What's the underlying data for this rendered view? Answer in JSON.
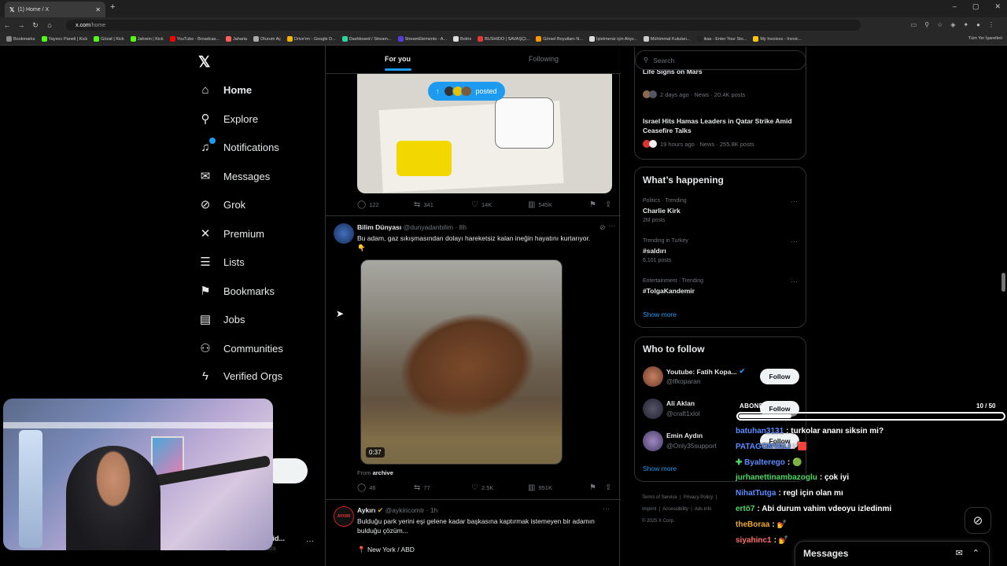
{
  "browser": {
    "tab_title": "(1) Home / X",
    "url_host": "x.com",
    "url_path": "/home",
    "bookmarks": [
      {
        "label": "Bookmarks",
        "color": "#888888"
      },
      {
        "label": "Yayıncı Paneli | Kick",
        "color": "#53fc18"
      },
      {
        "label": "Gözat | Kick",
        "color": "#53fc18"
      },
      {
        "label": "Jahrein | Kick",
        "color": "#53fc18"
      },
      {
        "label": "YouTube - Broadcas...",
        "color": "#ff0000"
      },
      {
        "label": "Jaharia",
        "color": "#ff5c5c"
      },
      {
        "label": "Oturum Aç",
        "color": "#aaaaaa"
      },
      {
        "label": "Drive'ım - Google D...",
        "color": "#f4b400"
      },
      {
        "label": "Dashboard / Stream...",
        "color": "#2bd5a0"
      },
      {
        "label": "StreamElements - A...",
        "color": "#5a3bdd"
      },
      {
        "label": "Botrix",
        "color": "#dddddd"
      },
      {
        "label": "BUSHIDO | SAVAŞÇI...",
        "color": "#e53935"
      },
      {
        "label": "Görsel Boyutlanı N...",
        "color": "#ff9800"
      },
      {
        "label": "İşletmeniz için Alışv...",
        "color": "#dddddd"
      },
      {
        "label": "Mühimmat Kutuları...",
        "color": "#cccccc"
      },
      {
        "label": "ikas - Enter Your Sto...",
        "color": "#222222"
      },
      {
        "label": "My Invoices - Invoic...",
        "color": "#f9c513"
      }
    ],
    "all_bookmarks": "Tüm Yer İşaretleri"
  },
  "nav": {
    "items": [
      {
        "label": "Home",
        "icon": "home-icon",
        "glyph": "⌂",
        "active": true
      },
      {
        "label": "Explore",
        "icon": "search-icon",
        "glyph": "⚲"
      },
      {
        "label": "Notifications",
        "icon": "bell-icon",
        "glyph": "♫",
        "badge": true
      },
      {
        "label": "Messages",
        "icon": "mail-icon",
        "glyph": "✉"
      },
      {
        "label": "Grok",
        "icon": "grok-icon",
        "glyph": "⊘"
      },
      {
        "label": "Premium",
        "icon": "x-premium-icon",
        "glyph": "✕"
      },
      {
        "label": "Lists",
        "icon": "list-icon",
        "glyph": "☰"
      },
      {
        "label": "Bookmarks",
        "icon": "bookmark-icon",
        "glyph": "⚑"
      },
      {
        "label": "Jobs",
        "icon": "briefcase-icon",
        "glyph": "▤"
      },
      {
        "label": "Communities",
        "icon": "people-icon",
        "glyph": "⚇"
      },
      {
        "label": "Verified Orgs",
        "icon": "lightning-icon",
        "glyph": "ϟ"
      }
    ],
    "profile_name": "shid...",
    "profile_handle": "@bushidowildcats"
  },
  "feed": {
    "tabs": {
      "for_you": "For you",
      "following": "Following"
    },
    "posted_pill": "posted",
    "post1_actions": {
      "replies": "122",
      "reposts": "341",
      "likes": "14K",
      "views": "545K"
    },
    "post2": {
      "name": "Bilim Dünyası",
      "handle": "@dunyadanbilim",
      "time": "8h",
      "text": "Bu adam, gaz sıkışmasından dolayı hareketsiz kalan ineğin hayatını kurtarıyor. 👇",
      "video_time": "0:37",
      "from_label": "From",
      "from_source": "archive",
      "actions": {
        "replies": "46",
        "reposts": "77",
        "likes": "2.5K",
        "views": "951K"
      }
    },
    "post3": {
      "name": "Aykırı",
      "handle": "@aykiricomtr",
      "time": "1h",
      "text": "Bulduğu park yerini eşi gelene kadar başkasına kaptırmak istemeyen bir adamın bulduğu çözüm...",
      "location": "📍 New York / ABD",
      "avatar_text": "AYKIRI"
    }
  },
  "sidebar": {
    "search_placeholder": "Search",
    "news": [
      {
        "title": "Life Signs on Mars",
        "meta": "2 days ago · News · 20.4K posts"
      },
      {
        "title": "Israel Hits Hamas Leaders in Qatar Strike Amid Ceasefire Talks",
        "meta": "19 hours ago · News · 255.8K posts"
      }
    ],
    "whats_happening_title": "What’s happening",
    "trends": [
      {
        "context": "Politics · Trending",
        "name": "Charlie Kirk",
        "posts": "2M posts"
      },
      {
        "context": "Trending in Turkey",
        "name": "#saldırı",
        "posts": "6,101 posts"
      },
      {
        "context": "Entertainment · Trending",
        "name": "#TolgaKandemir",
        "posts": ""
      }
    ],
    "show_more": "Show more",
    "who_to_follow_title": "Who to follow",
    "who_to_follow": [
      {
        "name": "Youtube: Fatih Kopa...",
        "handle": "@lfkoparan",
        "verified": true,
        "button": "Follow"
      },
      {
        "name": "Ali Aklan",
        "handle": "@craft1xlol",
        "verified": false,
        "button": "Follow"
      },
      {
        "name": "Emin Aydın",
        "handle": "@Only35support",
        "verified": false,
        "button": "Follow"
      }
    ],
    "footer": {
      "terms": "Terms of Service",
      "privacy": "Privacy Policy",
      "imprint": "Imprint",
      "accessibility": "Accessibility",
      "ads": "Ads info",
      "copyright": "© 2025 X Corp."
    }
  },
  "overlay": {
    "abone_label": "ABONE",
    "abone_count": "10 / 50",
    "abone_progress": 0.2,
    "chat": [
      {
        "user": "batuhan3131",
        "color": "#5b8cff",
        "msg": ": turkolar ananı siksin mi?"
      },
      {
        "user": "PATAGONYALI",
        "color": "#5b8cff",
        "msg": ": 🟥"
      },
      {
        "user": "Byalterego",
        "color": "#5b8cff",
        "msg": ": 🟢",
        "prefix": "✚"
      },
      {
        "user": "jurhanettinambazoglu",
        "color": "#4cd964",
        "msg": ": çok iyi"
      },
      {
        "user": "NihatTutga",
        "color": "#5b8cff",
        "msg": ": regl için olan mı"
      },
      {
        "user": "ertö7",
        "color": "#4cd964",
        "msg": ": Abi durum vahim vdeoyu izledinmi"
      },
      {
        "user": "theBoraa",
        "color": "#f0a830",
        "msg": ": 💅"
      },
      {
        "user": "siyahinc1",
        "color": "#ff6b6b",
        "msg": ": 💅"
      }
    ]
  },
  "messages_drawer": {
    "title": "Messages"
  }
}
